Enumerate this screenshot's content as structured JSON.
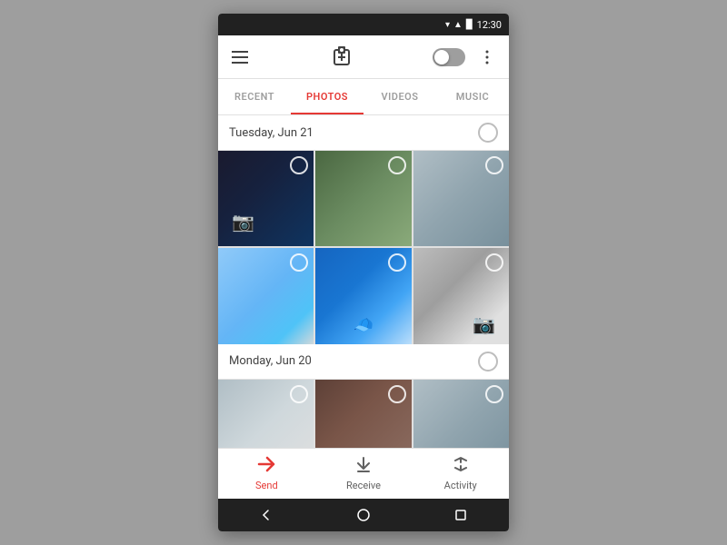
{
  "statusBar": {
    "time": "12:30"
  },
  "appBar": {
    "menuIconLabel": "menu",
    "moreIconLabel": "more"
  },
  "tabs": {
    "items": [
      {
        "id": "recent",
        "label": "RECENT",
        "active": false
      },
      {
        "id": "photos",
        "label": "PHOTOS",
        "active": true
      },
      {
        "id": "videos",
        "label": "VIDEOS",
        "active": false
      },
      {
        "id": "music",
        "label": "MUSIC",
        "active": false
      }
    ]
  },
  "dateGroups": [
    {
      "id": "group1",
      "dateLabel": "Tuesday, Jun 21",
      "photos": [
        {
          "id": "p1",
          "cssClass": "photo-1"
        },
        {
          "id": "p2",
          "cssClass": "photo-2"
        },
        {
          "id": "p3",
          "cssClass": "photo-3"
        },
        {
          "id": "p4",
          "cssClass": "photo-4"
        },
        {
          "id": "p5",
          "cssClass": "photo-5"
        },
        {
          "id": "p6",
          "cssClass": "photo-6"
        }
      ]
    },
    {
      "id": "group2",
      "dateLabel": "Monday, Jun 20",
      "photos": [
        {
          "id": "p7",
          "cssClass": "photo-7"
        },
        {
          "id": "p8",
          "cssClass": "photo-8"
        },
        {
          "id": "p9",
          "cssClass": "photo-3"
        }
      ]
    }
  ],
  "bottomNav": {
    "items": [
      {
        "id": "send",
        "label": "Send",
        "icon": "▶",
        "active": true
      },
      {
        "id": "receive",
        "label": "Receive",
        "icon": "⬇"
      },
      {
        "id": "activity",
        "label": "Activity",
        "icon": "↕"
      }
    ]
  },
  "systemNav": {
    "back": "◁",
    "home": "○",
    "recents": "□"
  }
}
